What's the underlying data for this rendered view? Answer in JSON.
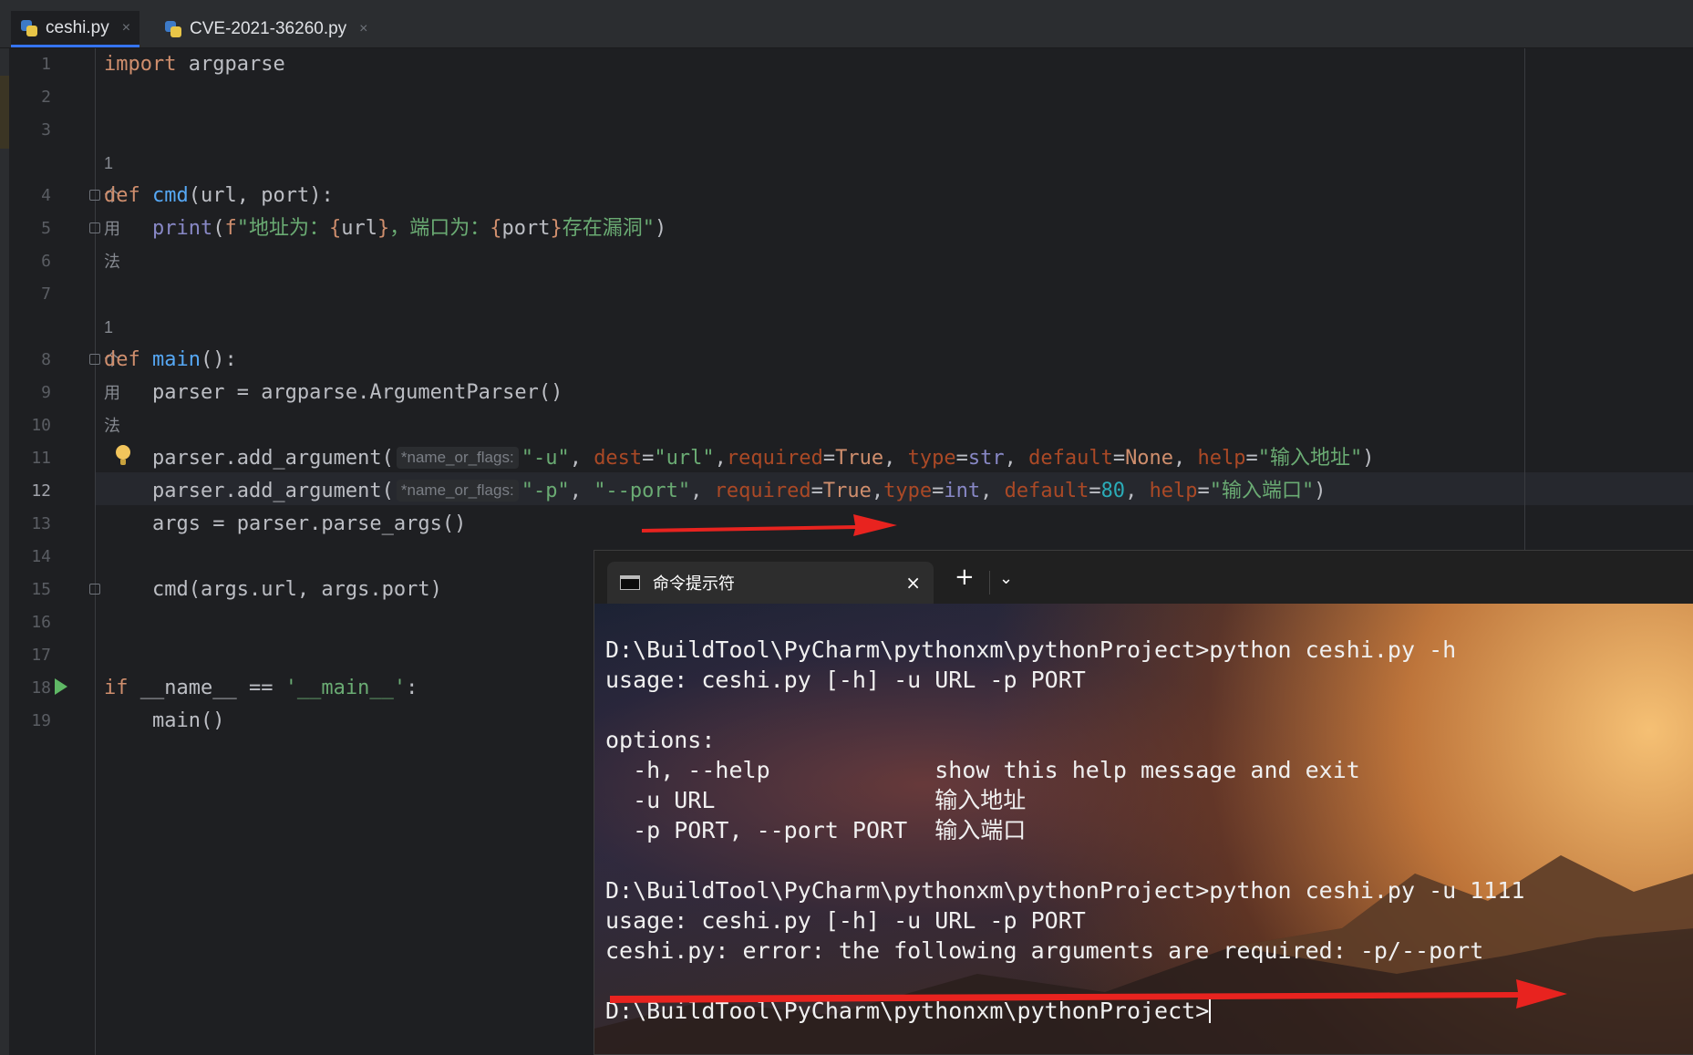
{
  "editor": {
    "tabs": [
      {
        "label": "ceshi.py",
        "close": "×"
      },
      {
        "label": "CVE-2021-36260.py",
        "close": "×"
      }
    ],
    "line_numbers": [
      "1",
      "2",
      "3",
      "4",
      "5",
      "6",
      "7",
      "8",
      "9",
      "10",
      "11",
      "12",
      "13",
      "14",
      "15",
      "16",
      "17",
      "18",
      "19"
    ],
    "current_line": "12",
    "usage_hint_1": "1 个用法",
    "usage_hint_2": "1 个用法",
    "param_hint": "*name_or_flags:",
    "code": {
      "l1_kw": "import",
      "l1_rest": " argparse",
      "l4_kw": "def",
      "l4_fn": "cmd",
      "l4_open": "(",
      "l4_p1": "url",
      "l4_comma": ", ",
      "l4_p2": "port",
      "l4_close": "):",
      "l5_print": "print",
      "l5_open": "(",
      "l5_f": "f",
      "l5_s1": "\"地址为：",
      "l5_b1": "{",
      "l5_v1": "url",
      "l5_b2": "}",
      "l5_s2": "，端口为：",
      "l5_b3": "{",
      "l5_v2": "port",
      "l5_b4": "}",
      "l5_s3": "存在漏洞\"",
      "l5_close": ")",
      "l8_kw": "def",
      "l8_fn": "main",
      "l8_rest": "():",
      "l9": "parser = argparse.ArgumentParser()",
      "l11_call": "parser.add_argument(",
      "l11_s1": "\"-u\"",
      "l11_c1": ", ",
      "l11_k1": "dest",
      "l11_eq1": "=",
      "l11_s2": "\"url\"",
      "l11_c2": ",",
      "l11_k2": "required",
      "l11_eq2": "=",
      "l11_v2": "True",
      "l11_c3": ", ",
      "l11_k3": "type",
      "l11_eq3": "=",
      "l11_v3": "str",
      "l11_c4": ", ",
      "l11_k4": "default",
      "l11_eq4": "=",
      "l11_v4": "None",
      "l11_c5": ", ",
      "l11_k5": "help",
      "l11_eq5": "=",
      "l11_s5": "\"输入地址\"",
      "l11_close": ")",
      "l12_call": "parser.add_argument(",
      "l12_s1": "\"-p\"",
      "l12_c1": ", ",
      "l12_s2": "\"--port\"",
      "l12_c2": ", ",
      "l12_k2": "required",
      "l12_eq2": "=",
      "l12_v2": "True",
      "l12_c3": ",",
      "l12_k3": "type",
      "l12_eq3": "=",
      "l12_v3": "int",
      "l12_c4": ", ",
      "l12_k4": "default",
      "l12_eq4": "=",
      "l12_v4": "80",
      "l12_c5": ", ",
      "l12_k5": "help",
      "l12_eq5": "=",
      "l12_s5": "\"输入端口\"",
      "l12_close": ")",
      "l13": "args = parser.parse_args()",
      "l15": "cmd(args.url, args.port)",
      "l18_kw": "if",
      "l18_mid": " __name__ == ",
      "l18_str": "'__main__'",
      "l18_end": ":",
      "l19": "main()"
    }
  },
  "terminal": {
    "tab_title": "命令提示符",
    "close": "×",
    "new_tab": "+",
    "dropdown": "⌄",
    "lines": [
      "D:\\BuildTool\\PyCharm\\pythonxm\\pythonProject>python ceshi.py -h",
      "usage: ceshi.py [-h] -u URL -p PORT",
      "",
      "options:",
      "  -h, --help            show this help message and exit",
      "  -u URL                输入地址",
      "  -p PORT, --port PORT  输入端口",
      "",
      "D:\\BuildTool\\PyCharm\\pythonxm\\pythonProject>python ceshi.py -u 1111",
      "usage: ceshi.py [-h] -u URL -p PORT",
      "ceshi.py: error: the following arguments are required: -p/--port",
      "",
      "D:\\BuildTool\\PyCharm\\pythonxm\\pythonProject>"
    ]
  },
  "colors": {
    "editor_bg": "#1e1f22",
    "keyword": "#cf8e6d",
    "string": "#6aab73",
    "function": "#56a8f5",
    "annotation_arrow": "#e8231f"
  }
}
